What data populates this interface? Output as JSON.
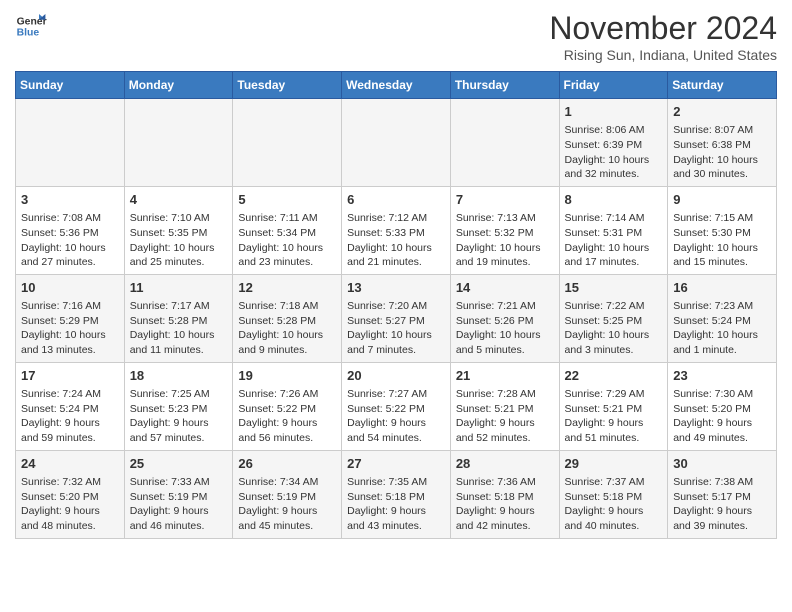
{
  "header": {
    "logo_line1": "General",
    "logo_line2": "Blue",
    "month_title": "November 2024",
    "location": "Rising Sun, Indiana, United States"
  },
  "calendar": {
    "days_of_week": [
      "Sunday",
      "Monday",
      "Tuesday",
      "Wednesday",
      "Thursday",
      "Friday",
      "Saturday"
    ],
    "weeks": [
      [
        {
          "day": "",
          "info": ""
        },
        {
          "day": "",
          "info": ""
        },
        {
          "day": "",
          "info": ""
        },
        {
          "day": "",
          "info": ""
        },
        {
          "day": "",
          "info": ""
        },
        {
          "day": "1",
          "info": "Sunrise: 8:06 AM\nSunset: 6:39 PM\nDaylight: 10 hours\nand 32 minutes."
        },
        {
          "day": "2",
          "info": "Sunrise: 8:07 AM\nSunset: 6:38 PM\nDaylight: 10 hours\nand 30 minutes."
        }
      ],
      [
        {
          "day": "3",
          "info": "Sunrise: 7:08 AM\nSunset: 5:36 PM\nDaylight: 10 hours\nand 27 minutes."
        },
        {
          "day": "4",
          "info": "Sunrise: 7:10 AM\nSunset: 5:35 PM\nDaylight: 10 hours\nand 25 minutes."
        },
        {
          "day": "5",
          "info": "Sunrise: 7:11 AM\nSunset: 5:34 PM\nDaylight: 10 hours\nand 23 minutes."
        },
        {
          "day": "6",
          "info": "Sunrise: 7:12 AM\nSunset: 5:33 PM\nDaylight: 10 hours\nand 21 minutes."
        },
        {
          "day": "7",
          "info": "Sunrise: 7:13 AM\nSunset: 5:32 PM\nDaylight: 10 hours\nand 19 minutes."
        },
        {
          "day": "8",
          "info": "Sunrise: 7:14 AM\nSunset: 5:31 PM\nDaylight: 10 hours\nand 17 minutes."
        },
        {
          "day": "9",
          "info": "Sunrise: 7:15 AM\nSunset: 5:30 PM\nDaylight: 10 hours\nand 15 minutes."
        }
      ],
      [
        {
          "day": "10",
          "info": "Sunrise: 7:16 AM\nSunset: 5:29 PM\nDaylight: 10 hours\nand 13 minutes."
        },
        {
          "day": "11",
          "info": "Sunrise: 7:17 AM\nSunset: 5:28 PM\nDaylight: 10 hours\nand 11 minutes."
        },
        {
          "day": "12",
          "info": "Sunrise: 7:18 AM\nSunset: 5:28 PM\nDaylight: 10 hours\nand 9 minutes."
        },
        {
          "day": "13",
          "info": "Sunrise: 7:20 AM\nSunset: 5:27 PM\nDaylight: 10 hours\nand 7 minutes."
        },
        {
          "day": "14",
          "info": "Sunrise: 7:21 AM\nSunset: 5:26 PM\nDaylight: 10 hours\nand 5 minutes."
        },
        {
          "day": "15",
          "info": "Sunrise: 7:22 AM\nSunset: 5:25 PM\nDaylight: 10 hours\nand 3 minutes."
        },
        {
          "day": "16",
          "info": "Sunrise: 7:23 AM\nSunset: 5:24 PM\nDaylight: 10 hours\nand 1 minute."
        }
      ],
      [
        {
          "day": "17",
          "info": "Sunrise: 7:24 AM\nSunset: 5:24 PM\nDaylight: 9 hours\nand 59 minutes."
        },
        {
          "day": "18",
          "info": "Sunrise: 7:25 AM\nSunset: 5:23 PM\nDaylight: 9 hours\nand 57 minutes."
        },
        {
          "day": "19",
          "info": "Sunrise: 7:26 AM\nSunset: 5:22 PM\nDaylight: 9 hours\nand 56 minutes."
        },
        {
          "day": "20",
          "info": "Sunrise: 7:27 AM\nSunset: 5:22 PM\nDaylight: 9 hours\nand 54 minutes."
        },
        {
          "day": "21",
          "info": "Sunrise: 7:28 AM\nSunset: 5:21 PM\nDaylight: 9 hours\nand 52 minutes."
        },
        {
          "day": "22",
          "info": "Sunrise: 7:29 AM\nSunset: 5:21 PM\nDaylight: 9 hours\nand 51 minutes."
        },
        {
          "day": "23",
          "info": "Sunrise: 7:30 AM\nSunset: 5:20 PM\nDaylight: 9 hours\nand 49 minutes."
        }
      ],
      [
        {
          "day": "24",
          "info": "Sunrise: 7:32 AM\nSunset: 5:20 PM\nDaylight: 9 hours\nand 48 minutes."
        },
        {
          "day": "25",
          "info": "Sunrise: 7:33 AM\nSunset: 5:19 PM\nDaylight: 9 hours\nand 46 minutes."
        },
        {
          "day": "26",
          "info": "Sunrise: 7:34 AM\nSunset: 5:19 PM\nDaylight: 9 hours\nand 45 minutes."
        },
        {
          "day": "27",
          "info": "Sunrise: 7:35 AM\nSunset: 5:18 PM\nDaylight: 9 hours\nand 43 minutes."
        },
        {
          "day": "28",
          "info": "Sunrise: 7:36 AM\nSunset: 5:18 PM\nDaylight: 9 hours\nand 42 minutes."
        },
        {
          "day": "29",
          "info": "Sunrise: 7:37 AM\nSunset: 5:18 PM\nDaylight: 9 hours\nand 40 minutes."
        },
        {
          "day": "30",
          "info": "Sunrise: 7:38 AM\nSunset: 5:17 PM\nDaylight: 9 hours\nand 39 minutes."
        }
      ]
    ]
  }
}
